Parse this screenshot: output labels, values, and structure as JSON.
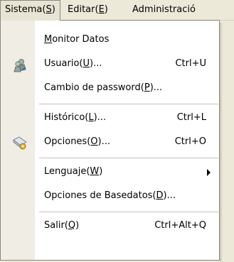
{
  "menubar": {
    "items": [
      {
        "label": "Sistema(",
        "key": "S",
        "tail": ")"
      },
      {
        "label": "Editar(",
        "key": "E",
        "tail": ")"
      },
      {
        "label": "Administració",
        "key": "",
        "tail": ""
      }
    ]
  },
  "menu": {
    "items": [
      {
        "pre": "",
        "key": "M",
        "post": "onitor Datos",
        "shortcut": "",
        "icon": ""
      },
      {
        "pre": "Usuario(",
        "key": "U",
        "post": ")...",
        "shortcut": "Ctrl+U",
        "icon": "users-icon"
      },
      {
        "pre": "Cambio de password(",
        "key": "P",
        "post": ")...",
        "shortcut": "",
        "icon": ""
      },
      {
        "pre": "Histórico(",
        "key": "L",
        "post": ")...",
        "shortcut": "Ctrl+L",
        "icon": ""
      },
      {
        "pre": "Opciones(",
        "key": "O",
        "post": ")...",
        "shortcut": "Ctrl+O",
        "icon": "gear-document-icon"
      },
      {
        "pre": "Lenguaje(",
        "key": "W",
        "post": ")",
        "shortcut": "",
        "icon": "",
        "submenu": true
      },
      {
        "pre": "Opciones de Basedatos(",
        "key": "D",
        "post": ")...",
        "shortcut": "",
        "icon": ""
      },
      {
        "pre": "Salir(",
        "key": "Q",
        "post": ")",
        "shortcut": "Ctrl+Alt+Q",
        "icon": ""
      }
    ]
  },
  "colors": {
    "menubar_bg": "#ece9d8",
    "gutter_bg": "#efede4",
    "menu_bg": "#ffffff",
    "separator": "#c5c2b8"
  }
}
